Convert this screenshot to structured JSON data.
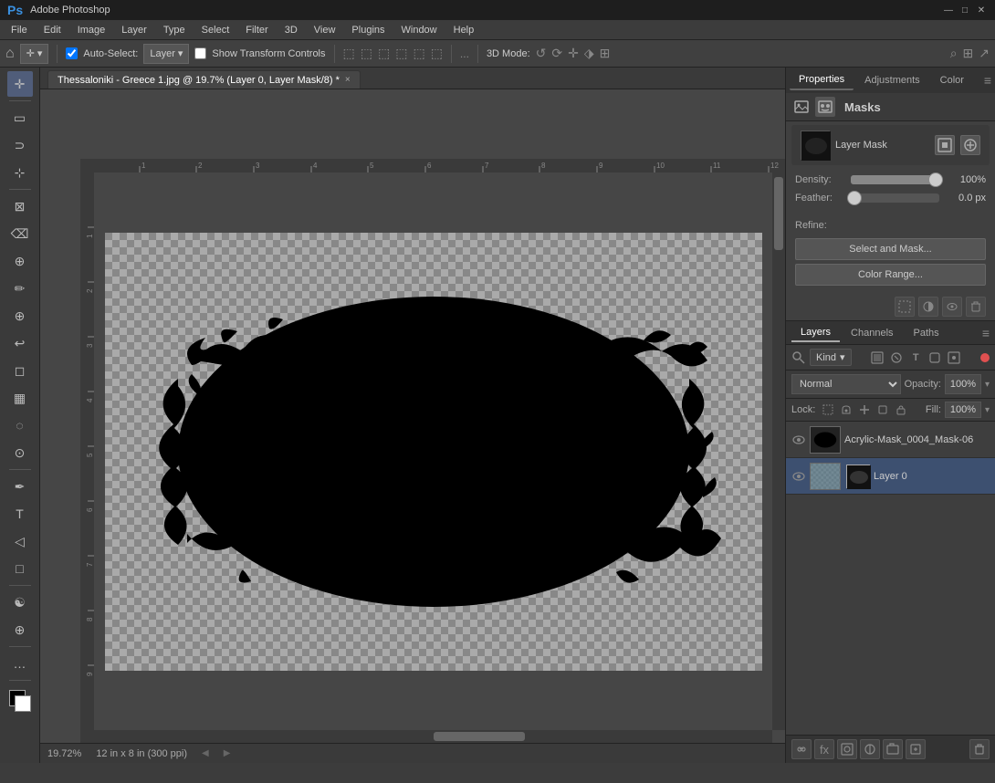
{
  "titlebar": {
    "title": "Adobe Photoshop",
    "menus": [
      "Ps",
      "File",
      "Edit",
      "Image",
      "Layer",
      "Type",
      "Select",
      "Filter",
      "3D",
      "View",
      "Plugins",
      "Window",
      "Help"
    ],
    "controls": [
      "—",
      "□",
      "✕"
    ]
  },
  "optionsbar": {
    "tool": "Move",
    "auto_select_label": "Auto-Select:",
    "auto_select_value": "Layer",
    "show_transform": "Show Transform Controls",
    "align_icons": [
      "⬛",
      "⬛",
      "⬛",
      "⬛",
      "⬛",
      "⬛",
      "⬛",
      "⬛",
      "⬛",
      "⬛",
      "⬛"
    ],
    "mode_3d_label": "3D Mode:",
    "extra": "..."
  },
  "tab": {
    "label": "Thessaloniki - Greece 1.jpg @ 19.7% (Layer 0, Layer Mask/8) *",
    "close": "×"
  },
  "canvas": {
    "zoom": "19.72%",
    "size": "12 in x 8 in (300 ppi)"
  },
  "ruler": {
    "marks": [
      "1",
      "2",
      "3",
      "4",
      "5",
      "6",
      "7",
      "8",
      "9",
      "10",
      "11",
      "12"
    ],
    "v_marks": [
      "1",
      "2",
      "3",
      "4",
      "5",
      "6",
      "7",
      "8",
      "9"
    ]
  },
  "properties": {
    "tabs": [
      "Properties",
      "Adjustments",
      "Color"
    ],
    "active_tab": "Properties",
    "icons": [
      "image",
      "mask"
    ],
    "masks_title": "Masks",
    "mask_label": "Layer Mask",
    "density_label": "Density:",
    "density_value": "100%",
    "feather_label": "Feather:",
    "feather_value": "0.0 px",
    "refine_label": "Refine:",
    "select_mask_btn": "Select and Mask...",
    "color_range_btn": "Color Range...",
    "action_icons": [
      "dotted-square",
      "target",
      "eye",
      "trash"
    ]
  },
  "layers": {
    "tabs": [
      "Layers",
      "Channels",
      "Paths"
    ],
    "active_tab": "Layers",
    "filter_kind": "Kind",
    "mode": "Normal",
    "opacity_label": "Opacity:",
    "opacity_value": "100%",
    "lock_label": "Lock:",
    "fill_label": "Fill:",
    "fill_value": "100%",
    "items": [
      {
        "name": "Acrylic-Mask_0004_Mask-06",
        "visible": true,
        "has_mask": false,
        "active": false
      },
      {
        "name": "Layer 0",
        "visible": true,
        "has_mask": true,
        "active": true
      }
    ],
    "bottom_buttons": [
      "fx",
      "camera",
      "circle-half",
      "folder",
      "page",
      "trash"
    ]
  },
  "colors": {
    "bg": "#3c3c3c",
    "panel_bg": "#404040",
    "active_layer": "#3d5070",
    "toolbar_bg": "#3a3a3a",
    "accent": "#505d7a",
    "titlebar": "#1e1e1e",
    "menubar": "#3c3c3c"
  }
}
